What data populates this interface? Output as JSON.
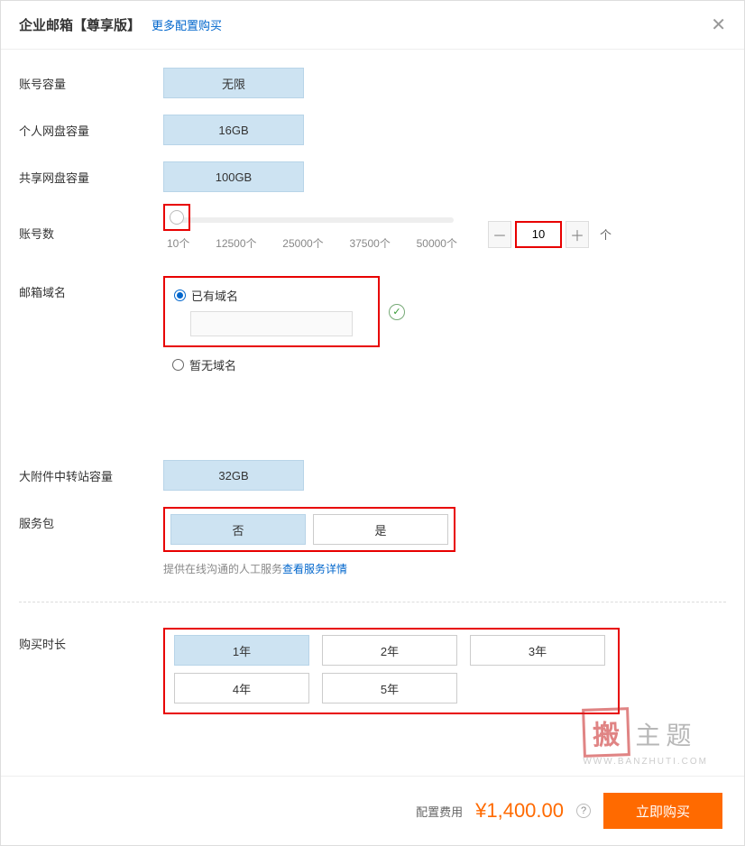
{
  "header": {
    "title": "企业邮箱【尊享版】",
    "more_link": "更多配置购买"
  },
  "labels": {
    "account_capacity": "账号容量",
    "personal_disk": "个人网盘容量",
    "shared_disk": "共享网盘容量",
    "account_count": "账号数",
    "mail_domain": "邮箱域名",
    "large_attach": "大附件中转站容量",
    "service_pack": "服务包",
    "duration": "购买时长"
  },
  "values": {
    "account_capacity": "无限",
    "personal_disk": "16GB",
    "shared_disk": "100GB",
    "large_attach": "32GB"
  },
  "slider": {
    "ticks": [
      "10个",
      "12500个",
      "25000个",
      "37500个",
      "50000个"
    ],
    "value": "10",
    "unit": "个"
  },
  "domain": {
    "existing_label": "已有域名",
    "none_label": "暂无域名",
    "input_value": ""
  },
  "service_pack": {
    "options": [
      "否",
      "是"
    ],
    "selected": 0,
    "hint_text": "提供在线沟通的人工服务",
    "hint_link": "查看服务详情"
  },
  "duration": {
    "options": [
      "1年",
      "2年",
      "3年",
      "4年",
      "5年"
    ],
    "selected": 0
  },
  "footer": {
    "label": "配置费用",
    "price": "¥1,400.00",
    "buy": "立即购买"
  },
  "watermark": {
    "stamp": "搬",
    "text": "主题",
    "sub": "WWW.BANZHUTI.COM"
  }
}
